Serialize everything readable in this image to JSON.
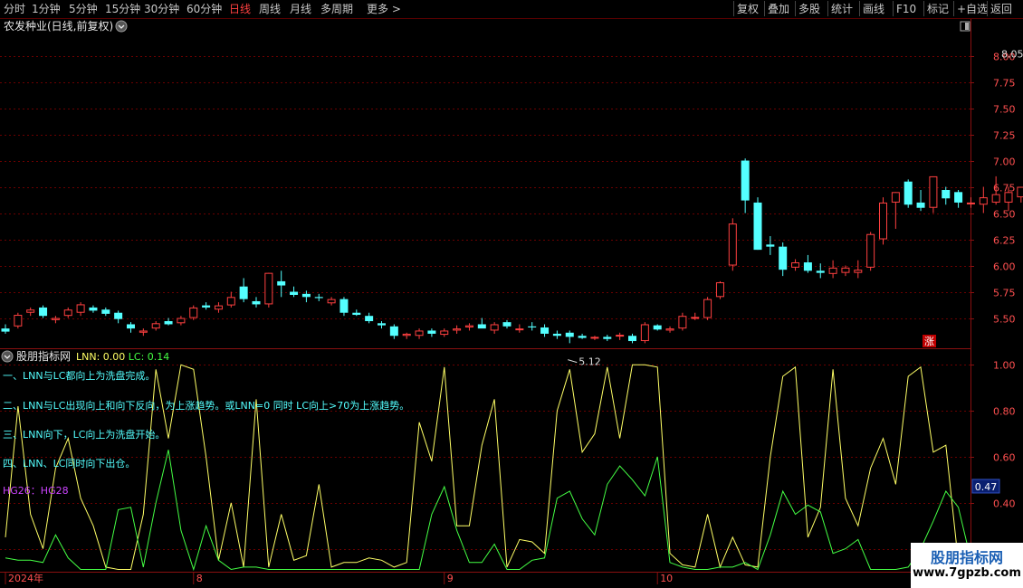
{
  "toolbar": {
    "left_items": [
      "分时",
      "1分钟",
      "5分钟",
      "15分钟",
      "30分钟",
      "60分钟",
      "日线",
      "周线",
      "月线",
      "多周期",
      "更多 >"
    ],
    "active": "日线",
    "right_items": [
      "复权",
      "叠加",
      "多股",
      "统计",
      "画线",
      "F10",
      "标记",
      "+自选",
      "返回"
    ]
  },
  "chart_data": [
    {
      "type": "candlestick",
      "title": "农发种业(日线,前复权)",
      "ylim": [
        5.22,
        8.22
      ],
      "yticks": [
        "8.00",
        "7.75",
        "7.50",
        "7.25",
        "7.00",
        "6.75",
        "6.50",
        "6.25",
        "6.00",
        "5.75",
        "5.50"
      ],
      "ytick_values": [
        8.0,
        7.75,
        7.5,
        7.25,
        7.0,
        6.75,
        6.5,
        6.25,
        6.0,
        5.75,
        5.5
      ],
      "annotations": {
        "max_label": "8.05",
        "max_value": 8.05,
        "min_label": "5.12",
        "min_value": 5.12
      },
      "badge": "涨",
      "colors": {
        "up": "#ff4040",
        "down": "#54ffff"
      },
      "ohlc": [
        [
          5.4,
          5.44,
          5.35,
          5.37
        ],
        [
          5.42,
          5.55,
          5.4,
          5.53
        ],
        [
          5.55,
          5.6,
          5.52,
          5.58
        ],
        [
          5.6,
          5.62,
          5.5,
          5.52
        ],
        [
          5.48,
          5.52,
          5.45,
          5.5
        ],
        [
          5.52,
          5.6,
          5.5,
          5.58
        ],
        [
          5.55,
          5.65,
          5.52,
          5.63
        ],
        [
          5.6,
          5.62,
          5.55,
          5.57
        ],
        [
          5.58,
          5.6,
          5.52,
          5.54
        ],
        [
          5.55,
          5.57,
          5.45,
          5.49
        ],
        [
          5.44,
          5.46,
          5.36,
          5.4
        ],
        [
          5.36,
          5.4,
          5.33,
          5.38
        ],
        [
          5.4,
          5.47,
          5.38,
          5.45
        ],
        [
          5.47,
          5.5,
          5.43,
          5.44
        ],
        [
          5.45,
          5.52,
          5.43,
          5.5
        ],
        [
          5.5,
          5.62,
          5.48,
          5.6
        ],
        [
          5.62,
          5.65,
          5.58,
          5.6
        ],
        [
          5.58,
          5.65,
          5.55,
          5.62
        ],
        [
          5.62,
          5.75,
          5.6,
          5.7
        ],
        [
          5.8,
          5.88,
          5.65,
          5.68
        ],
        [
          5.66,
          5.7,
          5.6,
          5.63
        ],
        [
          5.63,
          5.93,
          5.6,
          5.93
        ],
        [
          5.85,
          5.95,
          5.7,
          5.81
        ],
        [
          5.75,
          5.8,
          5.7,
          5.72
        ],
        [
          5.73,
          5.76,
          5.65,
          5.7
        ],
        [
          5.7,
          5.73,
          5.66,
          5.69
        ],
        [
          5.64,
          5.7,
          5.62,
          5.68
        ],
        [
          5.68,
          5.7,
          5.52,
          5.55
        ],
        [
          5.55,
          5.58,
          5.52,
          5.53
        ],
        [
          5.52,
          5.55,
          5.45,
          5.47
        ],
        [
          5.45,
          5.47,
          5.4,
          5.43
        ],
        [
          5.42,
          5.44,
          5.3,
          5.33
        ],
        [
          5.33,
          5.36,
          5.3,
          5.35
        ],
        [
          5.33,
          5.4,
          5.3,
          5.38
        ],
        [
          5.38,
          5.4,
          5.32,
          5.35
        ],
        [
          5.34,
          5.4,
          5.32,
          5.38
        ],
        [
          5.38,
          5.43,
          5.35,
          5.4
        ],
        [
          5.41,
          5.45,
          5.38,
          5.43
        ],
        [
          5.44,
          5.5,
          5.42,
          5.4
        ],
        [
          5.38,
          5.46,
          5.35,
          5.44
        ],
        [
          5.46,
          5.48,
          5.4,
          5.42
        ],
        [
          5.4,
          5.44,
          5.36,
          5.4
        ],
        [
          5.42,
          5.46,
          5.38,
          5.41
        ],
        [
          5.41,
          5.44,
          5.32,
          5.35
        ],
        [
          5.35,
          5.38,
          5.3,
          5.33
        ],
        [
          5.36,
          5.38,
          5.26,
          5.32
        ],
        [
          5.33,
          5.35,
          5.3,
          5.31
        ],
        [
          5.31,
          5.33,
          5.29,
          5.32
        ],
        [
          5.32,
          5.34,
          5.28,
          5.3
        ],
        [
          5.33,
          5.36,
          5.29,
          5.34
        ],
        [
          5.33,
          5.35,
          5.26,
          5.28
        ],
        [
          5.28,
          5.46,
          5.26,
          5.44
        ],
        [
          5.43,
          5.44,
          5.38,
          5.39
        ],
        [
          5.38,
          5.42,
          5.36,
          5.4
        ],
        [
          5.4,
          5.55,
          5.38,
          5.52
        ],
        [
          5.5,
          5.55,
          5.48,
          5.51
        ],
        [
          5.5,
          5.7,
          5.48,
          5.68
        ],
        [
          5.7,
          5.85,
          5.68,
          5.84
        ],
        [
          6.0,
          6.45,
          5.95,
          6.4
        ],
        [
          7.0,
          7.02,
          6.5,
          6.62
        ],
        [
          6.6,
          6.65,
          6.15,
          6.15
        ],
        [
          6.2,
          6.28,
          6.1,
          6.18
        ],
        [
          6.18,
          6.22,
          5.9,
          5.96
        ],
        [
          5.98,
          6.06,
          5.95,
          6.03
        ],
        [
          6.03,
          6.1,
          5.93,
          5.95
        ],
        [
          5.95,
          6.02,
          5.88,
          5.93
        ],
        [
          5.92,
          6.05,
          5.88,
          5.98
        ],
        [
          5.93,
          6.0,
          5.9,
          5.98
        ],
        [
          5.93,
          6.05,
          5.88,
          5.96
        ],
        [
          5.98,
          6.32,
          5.95,
          6.3
        ],
        [
          6.25,
          6.65,
          6.2,
          6.6
        ],
        [
          6.6,
          6.7,
          6.35,
          6.7
        ],
        [
          6.8,
          6.82,
          6.55,
          6.58
        ],
        [
          6.6,
          6.72,
          6.52,
          6.55
        ],
        [
          6.55,
          6.85,
          6.5,
          6.85
        ],
        [
          6.72,
          6.75,
          6.58,
          6.64
        ],
        [
          6.7,
          6.72,
          6.55,
          6.6
        ],
        [
          6.6,
          6.65,
          6.55,
          6.6
        ],
        [
          6.58,
          6.75,
          6.5,
          6.65
        ],
        [
          6.6,
          6.85,
          6.58,
          6.68
        ],
        [
          6.6,
          6.75,
          6.52,
          6.7
        ],
        [
          6.65,
          6.75,
          6.6,
          6.75
        ],
        [
          6.78,
          7.42,
          6.75,
          7.42
        ],
        [
          7.7,
          8.05,
          7.5,
          7.7
        ],
        [
          7.64,
          7.7,
          7.35,
          7.53
        ],
        [
          7.6,
          7.62,
          7.3,
          7.45
        ]
      ]
    },
    {
      "type": "line",
      "title": "股朋指标网",
      "legend": [
        {
          "name": "LNN",
          "value": "0.00"
        },
        {
          "name": "LC",
          "value": "0.14"
        }
      ],
      "ylim": [
        0.1,
        1.06
      ],
      "yticks": [
        "1.00",
        "0.80",
        "0.60",
        "0.40",
        "0.20"
      ],
      "ytick_values": [
        1.0,
        0.8,
        0.6,
        0.4,
        0.2
      ],
      "current_value": "0.47",
      "x_labels": [
        {
          "label": "2024年",
          "index": 0
        },
        {
          "label": "8",
          "index": 15
        },
        {
          "label": "9",
          "index": 35
        },
        {
          "label": "10",
          "index": 52
        }
      ],
      "texts": [
        "一、LNN与LC都向上为洗盘完成。",
        "二、LNN与LC出现向上和向下反向，为上涨趋势。或LNN=0 同时 LC向上>70为上涨趋势。",
        "三、LNN向下，LC向上为洗盘开始。",
        "四、LNN、LC同时向下出仓。",
        "HG26：HG28"
      ],
      "series": [
        {
          "name": "LNN",
          "color": "#ffff66",
          "values": [
            0.25,
            0.82,
            0.35,
            0.2,
            0.55,
            0.68,
            0.42,
            0.3,
            0.12,
            0.11,
            0.11,
            0.35,
            0.98,
            0.68,
            1.0,
            0.98,
            0.6,
            0.15,
            0.4,
            0.12,
            0.85,
            0.12,
            0.35,
            0.15,
            0.17,
            0.48,
            0.12,
            0.14,
            0.14,
            0.16,
            0.15,
            0.12,
            0.14,
            0.75,
            0.58,
            0.99,
            0.3,
            0.3,
            0.65,
            0.85,
            0.12,
            0.24,
            0.23,
            0.18,
            0.8,
            0.98,
            0.62,
            0.7,
            0.99,
            0.68,
            1.0,
            1.0,
            0.99,
            0.18,
            0.13,
            0.12,
            0.35,
            0.12,
            0.25,
            0.13,
            0.12,
            0.6,
            0.95,
            0.99,
            0.25,
            0.38,
            0.98,
            0.42,
            0.3,
            0.55,
            0.68,
            0.48,
            0.95,
            0.99,
            0.62,
            0.65,
            0.14
          ]
        },
        {
          "name": "LC",
          "color": "#44ff44",
          "values": [
            0.16,
            0.15,
            0.15,
            0.14,
            0.26,
            0.16,
            0.11,
            0.11,
            0.11,
            0.37,
            0.38,
            0.12,
            0.4,
            0.63,
            0.28,
            0.11,
            0.3,
            0.15,
            0.11,
            0.12,
            0.12,
            0.11,
            0.11,
            0.11,
            0.11,
            0.11,
            0.11,
            0.11,
            0.11,
            0.11,
            0.11,
            0.11,
            0.11,
            0.11,
            0.35,
            0.47,
            0.28,
            0.14,
            0.14,
            0.22,
            0.11,
            0.11,
            0.15,
            0.16,
            0.42,
            0.45,
            0.33,
            0.26,
            0.48,
            0.56,
            0.5,
            0.43,
            0.6,
            0.14,
            0.12,
            0.11,
            0.11,
            0.12,
            0.12,
            0.14,
            0.11,
            0.26,
            0.45,
            0.35,
            0.39,
            0.36,
            0.18,
            0.2,
            0.24,
            0.11,
            0.11,
            0.11,
            0.12,
            0.2,
            0.32,
            0.45,
            0.38,
            0.15
          ]
        }
      ]
    }
  ],
  "watermark": {
    "title": "股朋指标网",
    "url": "www.7gpzb.com"
  }
}
